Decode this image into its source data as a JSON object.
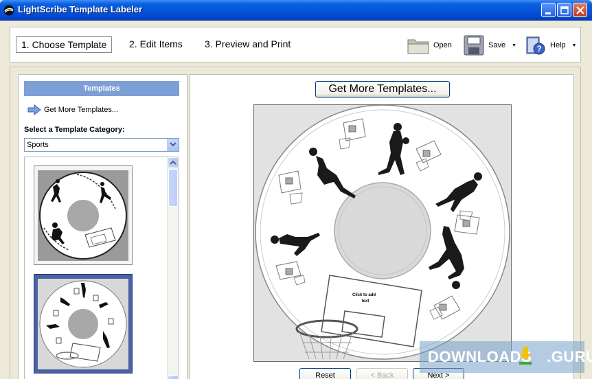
{
  "window": {
    "title": "LightScribe Template Labeler"
  },
  "steps": [
    {
      "label": "1. Choose Template"
    },
    {
      "label": "2. Edit Items"
    },
    {
      "label": "3. Preview and Print"
    }
  ],
  "toolbar": {
    "open_label": "Open",
    "save_label": "Save",
    "help_label": "Help"
  },
  "left_panel": {
    "header": "Templates",
    "get_more_link": "Get More Templates...",
    "category_label": "Select a Template Category:",
    "category_value": "Sports"
  },
  "right_panel": {
    "get_more_button": "Get More Templates...",
    "disc_text_line1": "Click to add",
    "disc_text_line2": "text"
  },
  "nav": {
    "reset": "Reset",
    "back": "< Back",
    "next": "Next >"
  },
  "watermark": {
    "text_left": "DOWNLOADS",
    "text_right": ".GURU"
  }
}
